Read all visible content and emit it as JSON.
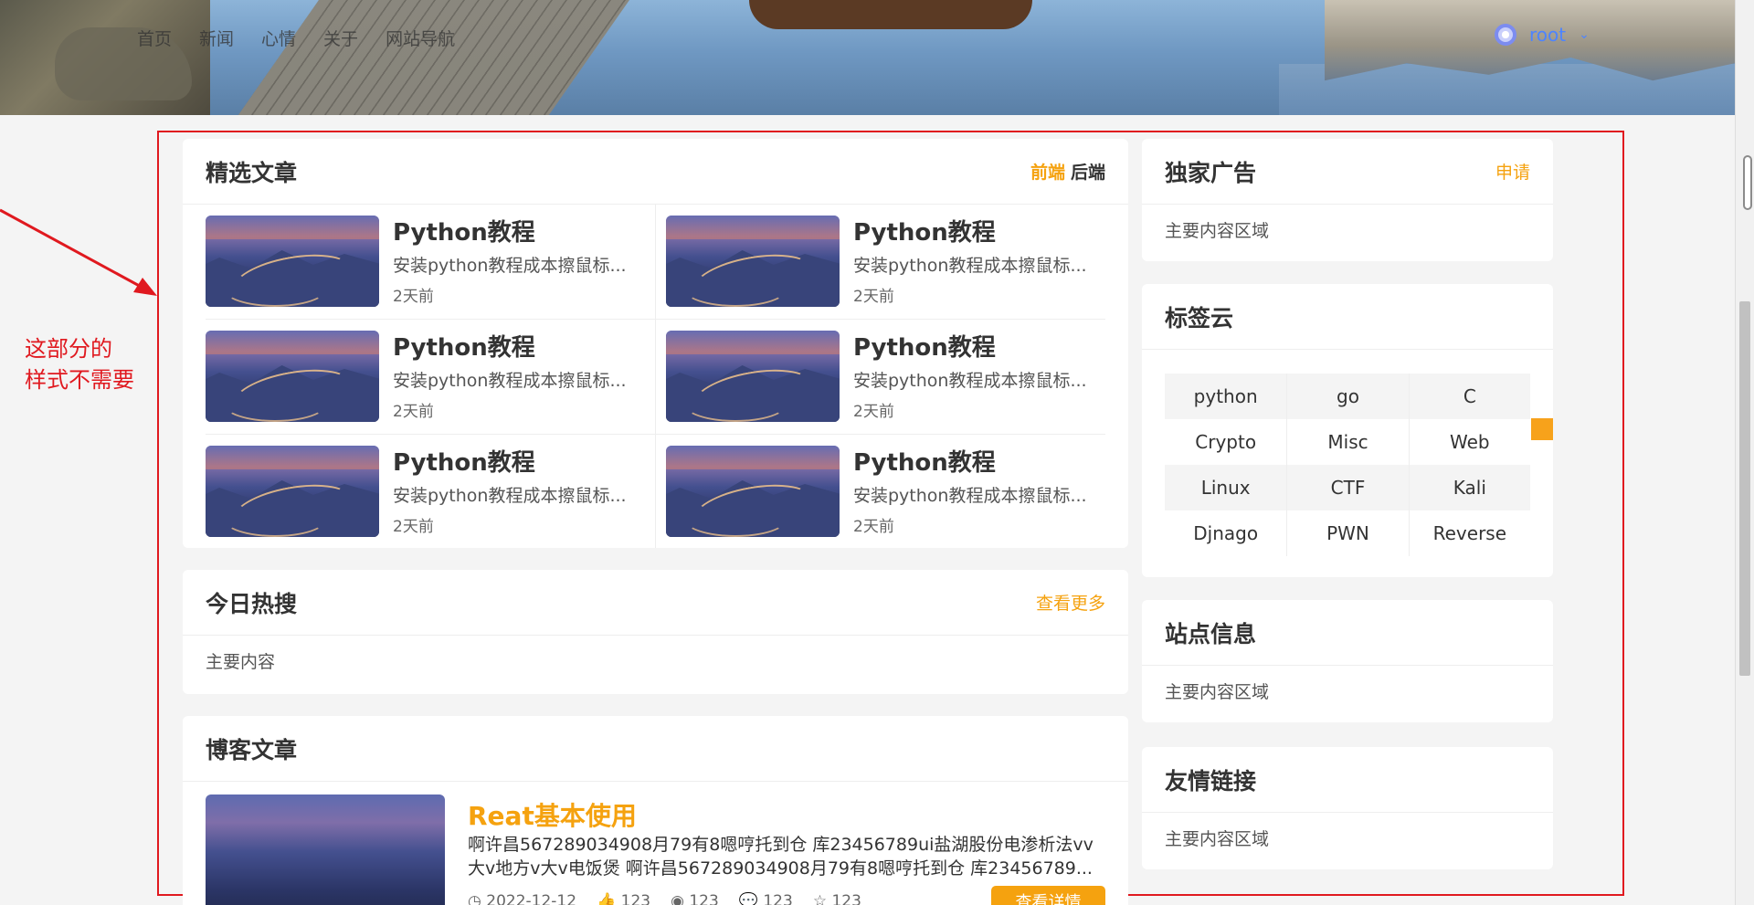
{
  "nav": {
    "items": [
      "首页",
      "新闻",
      "心情",
      "关于",
      "网站导航"
    ]
  },
  "user": {
    "name": "root"
  },
  "annotation": {
    "text": "这部分的\n样式不需要"
  },
  "featured": {
    "title": "精选文章",
    "tabs": [
      "前端",
      "后端"
    ],
    "items": [
      {
        "title": "Python教程",
        "desc": "安装python教程成本擦鼠标...",
        "time": "2天前"
      },
      {
        "title": "Python教程",
        "desc": "安装python教程成本擦鼠标...",
        "time": "2天前"
      },
      {
        "title": "Python教程",
        "desc": "安装python教程成本擦鼠标...",
        "time": "2天前"
      },
      {
        "title": "Python教程",
        "desc": "安装python教程成本擦鼠标...",
        "time": "2天前"
      },
      {
        "title": "Python教程",
        "desc": "安装python教程成本擦鼠标...",
        "time": "2天前"
      },
      {
        "title": "Python教程",
        "desc": "安装python教程成本擦鼠标...",
        "time": "2天前"
      }
    ]
  },
  "hot": {
    "title": "今日热搜",
    "more": "查看更多",
    "body": "主要内容"
  },
  "blog": {
    "title": "博客文章",
    "post": {
      "title": "Reat基本使用",
      "desc_line1": "啊许昌567289034908月79有8嗯哼托到仓 库23456789ui盐湖股份电渗析法vv",
      "desc_line2": "大v地方v大v电饭煲 啊许昌567289034908月79有8嗯哼托到仓 库23456789...",
      "date": "2022-12-12",
      "likes": "123",
      "views": "123",
      "comments": "123",
      "collects": "123",
      "button": "查看详情"
    }
  },
  "ad": {
    "title": "独家广告",
    "link": "申请",
    "body": "主要内容区域"
  },
  "tags": {
    "title": "标签云",
    "items": [
      "python",
      "go",
      "C",
      "Crypto",
      "Misc",
      "Web",
      "Linux",
      "CTF",
      "Kali",
      "Djnago",
      "PWN",
      "Reverse"
    ]
  },
  "site": {
    "title": "站点信息",
    "body": "主要内容区域"
  },
  "friends": {
    "title": "友情链接",
    "body": "主要内容区域"
  }
}
